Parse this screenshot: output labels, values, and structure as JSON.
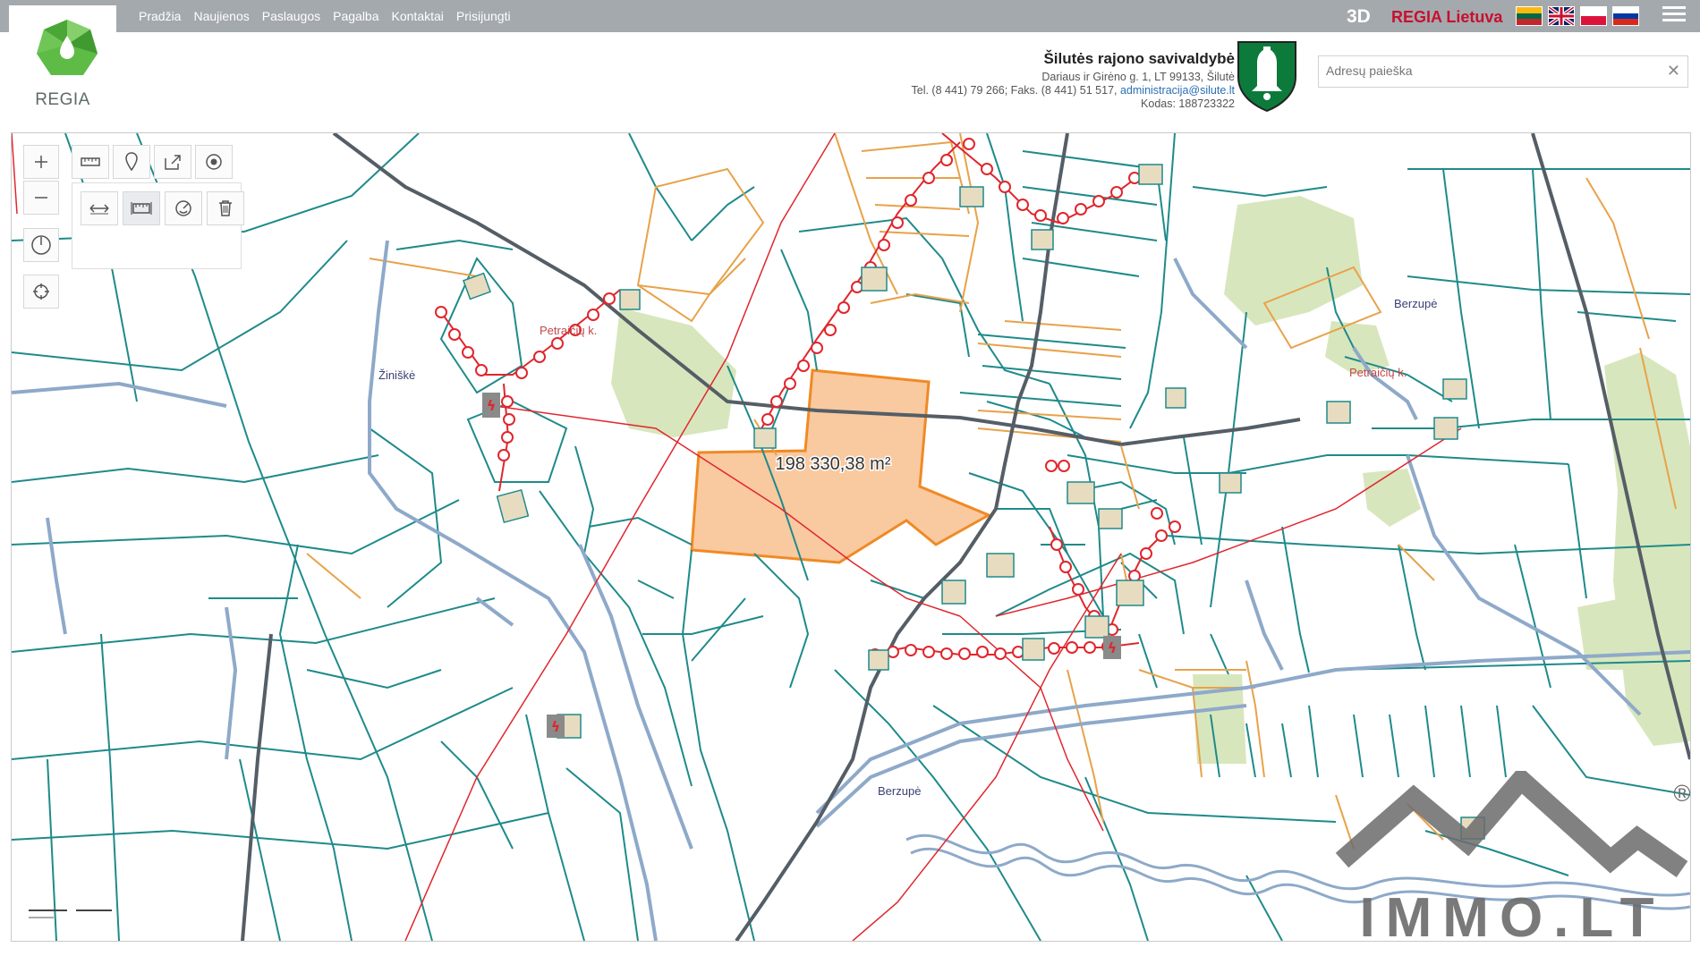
{
  "nav": {
    "items": [
      "Pradžia",
      "Naujienos",
      "Paslaugos",
      "Pagalba",
      "Kontaktai",
      "Prisijungti"
    ]
  },
  "brand": {
    "logo_text": "REGIA"
  },
  "topright": {
    "btn_3d": "3D",
    "regia_lt": "REGIA Lietuva",
    "flags": [
      "lt-flag-icon",
      "uk-flag-icon",
      "pl-flag-icon",
      "ru-flag-icon"
    ],
    "menu_icon": "hamburger-menu-icon"
  },
  "municipality": {
    "name": "Šilutės rajono savivaldybė",
    "address": "Dariaus ir Girėno g. 1, LT 99133, Šilutė",
    "phone_fax": "Tel. (8 441) 79 266; Faks. (8 441) 51 517, ",
    "email": "administracija@silute.lt",
    "code": "Kodas: 188723322"
  },
  "search": {
    "placeholder": "Adresų paieška",
    "value": ""
  },
  "tools": {
    "zoom_in": "plus-icon",
    "zoom_out": "minus-icon",
    "rotate": "compass-icon",
    "locate": "crosshair-icon",
    "measure_line": "ruler-icon",
    "marker": "pin-icon",
    "share": "share-icon",
    "radius": "circle-dot-icon",
    "measure_distance": "distance-icon",
    "measure_area": "area-ruler-icon",
    "measure_circle": "circle-measure-icon",
    "delete": "trash-icon"
  },
  "map": {
    "area_label": "198 330,38 m²",
    "places": [
      "Žiniškė",
      "Petraičių k.",
      "Berzupė",
      "Petraičių k.",
      "Berzupė"
    ]
  },
  "watermark": {
    "text": "IMMO.LT",
    "registered": "®"
  },
  "colors": {
    "parcel": "#1f8a8a",
    "highlight_fill": "#f9c9a0",
    "highlight_stroke": "#f08a24",
    "power_line": "#e0262d",
    "road": "#8ea9c9",
    "green": "#d8e6bd",
    "orange_lines": "#e8a24a"
  }
}
